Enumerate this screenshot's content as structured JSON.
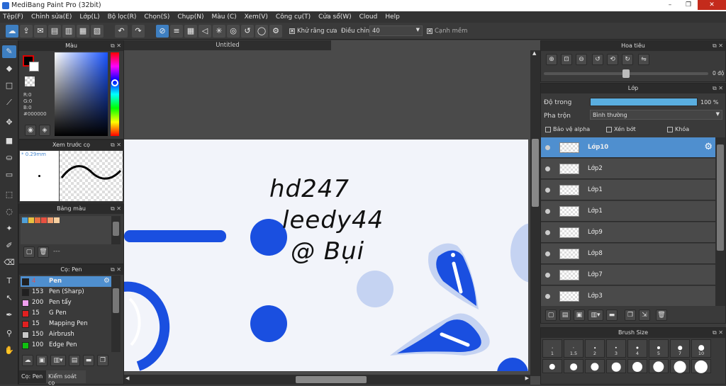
{
  "window": {
    "title": "MediBang Paint Pro (32bit)",
    "minimize": "–",
    "maximize": "❐",
    "close": "✕"
  },
  "menu": [
    "Tệp(F)",
    "Chỉnh sửa(E)",
    "Lớp(L)",
    "Bộ lọc(R)",
    "Chọn(S)",
    "Chụp(N)",
    "Màu (C)",
    "Xem(V)",
    "Công cụ(T)",
    "Cửa sổ(W)",
    "Cloud",
    "Help"
  ],
  "toolbar": {
    "antialias_label": "Khử răng cưa",
    "adjust_label": "Điều chỉnh",
    "adjust_value": "40",
    "edge_label": "Cạnh mềm"
  },
  "color_panel": {
    "title": "Màu",
    "r": "R:0",
    "g": "G:0",
    "b": "B:0",
    "hex": "#000000",
    "fg_color": "#000000",
    "bg_color": "#ffffff"
  },
  "preview_panel": {
    "title": "Xem trước cọ",
    "size": "0.29mm"
  },
  "palette_panel": {
    "title": "Bảng màu",
    "swatches": [
      "#4fa0d8",
      "#e8c040",
      "#e87040",
      "#e85040",
      "#f0a070",
      "#f8d0a0"
    ],
    "dash": "---"
  },
  "brush_panel": {
    "title": "Cọ: Pen",
    "items": [
      {
        "size": "4",
        "name": "Pen",
        "color": "#202020"
      },
      {
        "size": "153",
        "name": "Pen (Sharp)",
        "color": "#202020"
      },
      {
        "size": "200",
        "name": "Pen tẩy",
        "color": "#f0a0f0"
      },
      {
        "size": "15",
        "name": "G Pen",
        "color": "#e02020"
      },
      {
        "size": "15",
        "name": "Mapping Pen",
        "color": "#e02020"
      },
      {
        "size": "150",
        "name": "Airbrush",
        "color": "#c8c8c8"
      },
      {
        "size": "100",
        "name": "Edge Pen",
        "color": "#10c010"
      }
    ],
    "tab1": "Cọ: Pen",
    "tab2": "Kiểm soát cọ"
  },
  "canvas": {
    "tab_title": "Untitled",
    "text_line1": "hd247",
    "text_line2": "leedy44",
    "text_line3": "@ Bụi"
  },
  "navigator": {
    "title": "Hoa tiêu",
    "angle": "0 độ"
  },
  "layer_panel": {
    "title": "Lớp",
    "opacity_label": "Độ trong",
    "opacity_value": "100 %",
    "opacity_fraction": 1.0,
    "blend_label": "Pha trộn",
    "blend_value": "Bình thường",
    "protect_alpha": "Bảo vệ alpha",
    "clipping": "Xén bớt",
    "lock": "Khóa",
    "layers": [
      "Lớp10",
      "Lớp2",
      "Lớp1",
      "Lớp1",
      "Lớp9",
      "Lớp8",
      "Lớp7",
      "Lớp3"
    ]
  },
  "brush_size": {
    "title": "Brush Size",
    "labels": [
      "1",
      "1.5",
      "2",
      "3",
      "4",
      "5",
      "7",
      "10"
    ]
  }
}
